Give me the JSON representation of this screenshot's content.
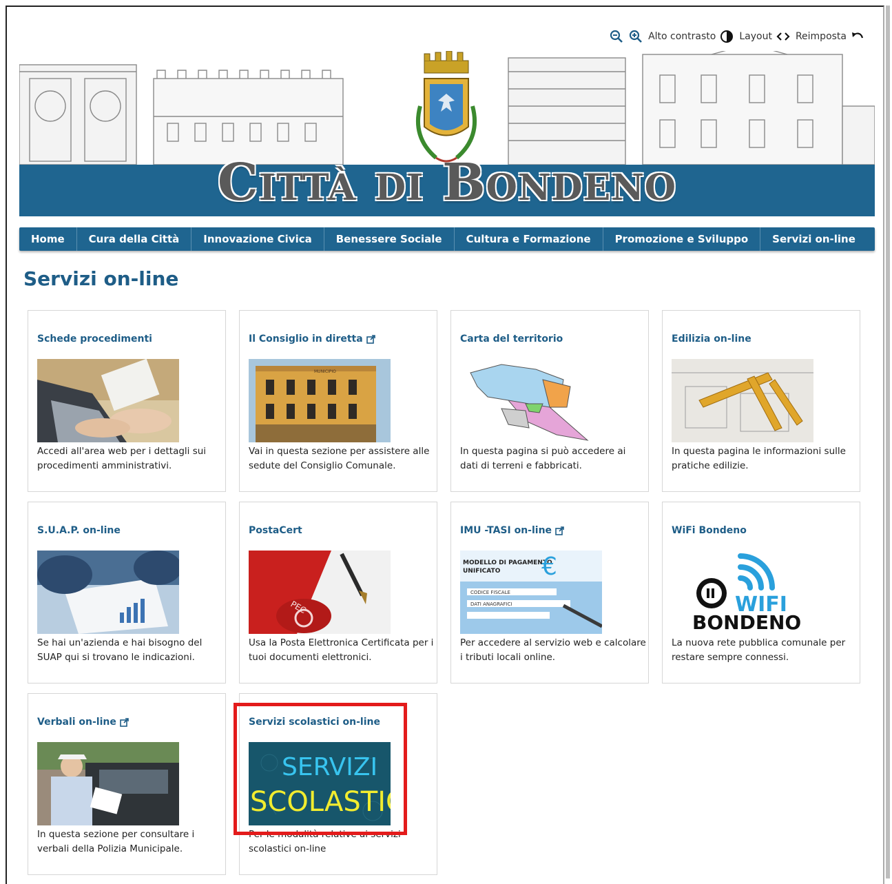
{
  "toolbar": {
    "zoom_out_icon": "zoom-out-icon",
    "zoom_in_icon": "zoom-in-icon",
    "contrast_label": "Alto contrasto",
    "layout_label": "Layout",
    "reset_label": "Reimposta"
  },
  "header": {
    "title": "Città di Bondeno"
  },
  "nav": {
    "items": [
      {
        "label": "Home"
      },
      {
        "label": "Cura della Città"
      },
      {
        "label": "Innovazione Civica"
      },
      {
        "label": "Benessere Sociale"
      },
      {
        "label": "Cultura e Formazione"
      },
      {
        "label": "Promozione e Sviluppo"
      },
      {
        "label": "Servizi on-line"
      }
    ]
  },
  "page": {
    "title": "Servizi on-line"
  },
  "cards": [
    {
      "title": "Schede procedimenti",
      "external": false,
      "description": "Accedi all'area web per i dettagli sui procedimenti amministrativi."
    },
    {
      "title": "Il Consiglio in diretta",
      "external": true,
      "description": "Vai in questa sezione per assistere alle sedute del Consiglio Comunale."
    },
    {
      "title": "Carta del territorio",
      "external": false,
      "description": "In questa pagina si può accedere ai dati di terreni e fabbricati."
    },
    {
      "title": "Edilizia on-line",
      "external": false,
      "description": "In questa pagina le informazioni sulle pratiche edilizie."
    },
    {
      "title": "S.U.A.P. on-line",
      "external": false,
      "description": "Se hai un'azienda e hai bisogno del SUAP qui si trovano le indicazioni."
    },
    {
      "title": "PostaCert",
      "external": false,
      "description": "Usa la Posta Elettronica Certificata per i tuoi documenti elettronici."
    },
    {
      "title": "IMU -TASI on-line",
      "external": true,
      "description": "Per accedere al servizio web e calcolare i tributi locali online."
    },
    {
      "title": "WiFi Bondeno",
      "external": false,
      "description": "La nuova rete pubblica comunale per restare sempre connessi."
    },
    {
      "title": "Verbali on-line",
      "external": true,
      "description": "In questa sezione per consultare i verbali della Polizia Municipale."
    },
    {
      "title": "Servizi scolastici on-line",
      "external": false,
      "description": "Per le modalità relative ai servizi scolastici on-line"
    }
  ],
  "images": {
    "wifi_logo": {
      "line1": "WIFI",
      "line2": "BONDENO"
    },
    "scolastici": {
      "line1": "SERVIZI",
      "line2": "SCOLASTICI"
    },
    "pec_label": "PEC",
    "imu_lines": [
      "MODELLO DI PAGAMENTO",
      "UNIFICATO",
      "CODICE FISCALE",
      "DATI ANAGRAFICI",
      "€"
    ],
    "bank_sign": "MUNICIPIO"
  },
  "colors": {
    "brand_blue": "#1f6590",
    "title_blue": "#1e5d87",
    "highlight_red": "#e31b1b"
  }
}
